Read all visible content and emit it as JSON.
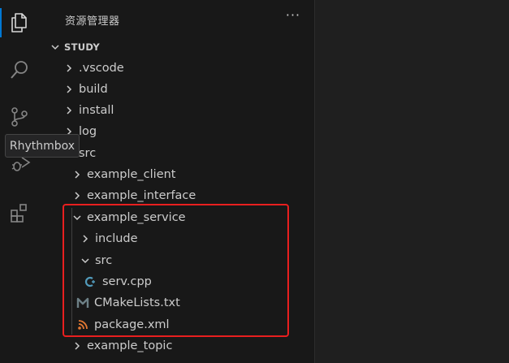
{
  "sidebar": {
    "title": "资源管理器",
    "more_label": "···",
    "section_title": "STUDY"
  },
  "tree": [
    {
      "label": ".vscode",
      "icon": "chevron-right-icon"
    },
    {
      "label": "build",
      "icon": "chevron-right-icon"
    },
    {
      "label": "install",
      "icon": "chevron-right-icon"
    },
    {
      "label": "log",
      "icon": "chevron-right-icon"
    },
    {
      "label": "src",
      "icon": "chevron-down-icon"
    },
    {
      "label": "example_client",
      "icon": "chevron-right-icon"
    },
    {
      "label": "example_interface",
      "icon": "chevron-right-icon"
    },
    {
      "label": "example_service",
      "icon": "chevron-down-icon"
    },
    {
      "label": "include",
      "icon": "chevron-right-icon"
    },
    {
      "label": "src",
      "icon": "chevron-down-icon"
    },
    {
      "label": "serv.cpp",
      "icon": "cpp-file-icon"
    },
    {
      "label": "CMakeLists.txt",
      "icon": "cmake-file-icon"
    },
    {
      "label": "package.xml",
      "icon": "xml-file-icon"
    },
    {
      "label": "example_topic",
      "icon": "chevron-right-icon"
    }
  ],
  "tooltip": {
    "text": "Rhythmbox"
  },
  "activity_bar": [
    "explorer-icon",
    "search-icon",
    "source-control-icon",
    "run-debug-icon",
    "extensions-icon"
  ],
  "colors": {
    "accent": "#0078d4",
    "highlight": "#e81f1f",
    "cpp": "#519aba",
    "cmake": "#6d8086",
    "xml": "#e37933"
  }
}
